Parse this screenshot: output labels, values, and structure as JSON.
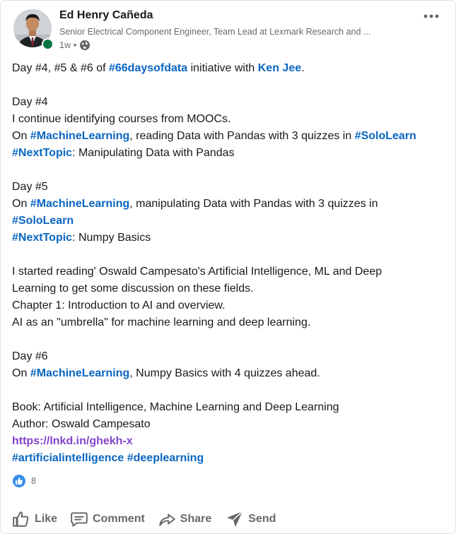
{
  "post": {
    "author": {
      "name": "Ed Henry Cañeda",
      "headline": "Senior Electrical Component Engineer, Team Lead at Lexmark Research and ...",
      "time": "1w",
      "separator": "•"
    },
    "lines": [
      [
        {
          "t": "Day #4, #5 & #6 of "
        },
        {
          "t": "#66daysofdata",
          "k": "tag"
        },
        {
          "t": " initiative with "
        },
        {
          "t": "Ken Jee",
          "k": "mention"
        },
        {
          "t": "."
        }
      ],
      [],
      [
        {
          "t": "Day #4"
        }
      ],
      [
        {
          "t": "I continue identifying courses from MOOCs."
        }
      ],
      [
        {
          "t": "On "
        },
        {
          "t": "#MachineLearning",
          "k": "tag"
        },
        {
          "t": ", reading Data with Pandas with 3 quizzes in "
        },
        {
          "t": "#SoloLearn",
          "k": "tag"
        }
      ],
      [
        {
          "t": "#NextTopic",
          "k": "tag"
        },
        {
          "t": ": Manipulating Data with Pandas"
        }
      ],
      [],
      [
        {
          "t": "Day #5"
        }
      ],
      [
        {
          "t": "On "
        },
        {
          "t": "#MachineLearning",
          "k": "tag"
        },
        {
          "t": ", manipulating Data with Pandas with 3 quizzes in"
        }
      ],
      [
        {
          "t": "#SoloLearn",
          "k": "tag"
        }
      ],
      [
        {
          "t": "#NextTopic",
          "k": "tag"
        },
        {
          "t": ": Numpy Basics"
        }
      ],
      [],
      [
        {
          "t": "I started reading' Oswald Campesato's Artificial Intelligence, ML and Deep"
        }
      ],
      [
        {
          "t": "Learning to get some discussion on these fields."
        }
      ],
      [
        {
          "t": "Chapter 1: Introduction to AI and overview."
        }
      ],
      [
        {
          "t": "AI as an \"umbrella\" for machine learning and deep learning."
        }
      ],
      [],
      [
        {
          "t": "Day #6"
        }
      ],
      [
        {
          "t": "On "
        },
        {
          "t": "#MachineLearning",
          "k": "tag"
        },
        {
          "t": ", Numpy Basics with 4 quizzes ahead."
        }
      ],
      [],
      [
        {
          "t": "Book: Artificial Intelligence, Machine Learning and Deep Learning"
        }
      ],
      [
        {
          "t": "Author: Oswald Campesato"
        }
      ],
      [
        {
          "t": "https://lnkd.in/ghekh-x",
          "k": "link"
        }
      ],
      [
        {
          "t": "#artificialintelligence",
          "k": "tag"
        },
        {
          "t": " "
        },
        {
          "t": "#deeplearning",
          "k": "tag"
        }
      ]
    ],
    "reactions": {
      "count": "8",
      "icon": "like-reaction-icon"
    }
  },
  "actions": [
    {
      "label": "Like",
      "icon": "thumbs-up-icon"
    },
    {
      "label": "Comment",
      "icon": "comment-icon"
    },
    {
      "label": "Share",
      "icon": "share-arrow-icon"
    },
    {
      "label": "Send",
      "icon": "send-icon"
    }
  ],
  "colors": {
    "hashtag": "#0a66c2",
    "link": "#8344cc",
    "online": "#057642",
    "reaction": "#378fe9"
  }
}
